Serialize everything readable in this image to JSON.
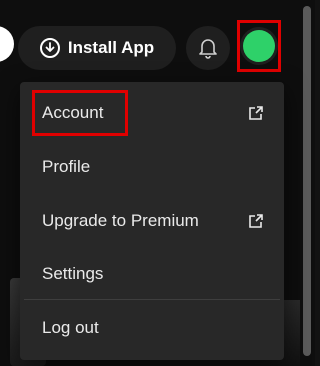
{
  "topbar": {
    "install_label": "Install App",
    "install_icon": "download-circle-icon",
    "bell_icon": "bell-icon",
    "avatar_color": "#2ed169"
  },
  "menu": {
    "items": [
      {
        "label": "Account",
        "external": true
      },
      {
        "label": "Profile",
        "external": false
      },
      {
        "label": "Upgrade to Premium",
        "external": true
      },
      {
        "label": "Settings",
        "external": false
      },
      {
        "label": "Log out",
        "external": false
      }
    ]
  },
  "colors": {
    "highlight": "#e00000",
    "menu_bg": "#282828",
    "button_bg": "#1f1f1f"
  }
}
